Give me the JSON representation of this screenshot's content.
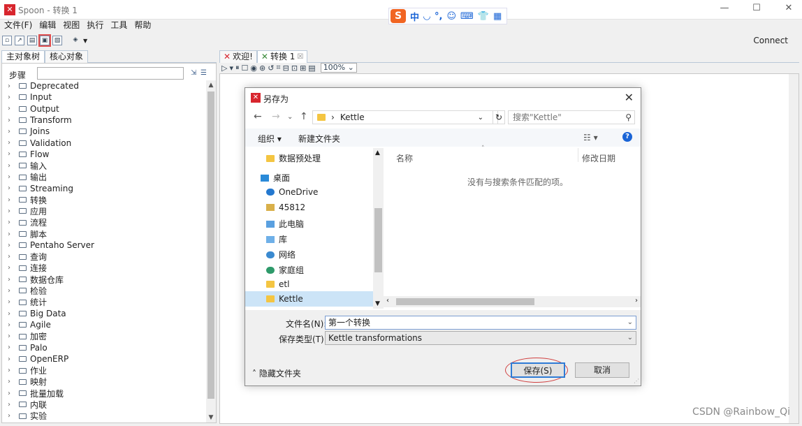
{
  "window": {
    "title": "Spoon - 转换 1",
    "icon": "kettle-icon",
    "minimize": "—",
    "maximize": "☐",
    "close": "✕"
  },
  "ime": {
    "logo": "S",
    "items": [
      "中",
      "◡",
      "°,",
      "☺",
      "⌨",
      "👕",
      "▦"
    ]
  },
  "menu": [
    "文件(F)",
    "编辑",
    "视图",
    "执行",
    "工具",
    "帮助"
  ],
  "toolbar": {
    "connect": "Connect"
  },
  "left_panel": {
    "tabs": [
      "主对象树",
      "核心对象"
    ],
    "steps_label": "步骤",
    "tree": [
      "Deprecated",
      "Input",
      "Output",
      "Transform",
      "Joins",
      "Validation",
      "Flow",
      "输入",
      "输出",
      "Streaming",
      "转换",
      "应用",
      "流程",
      "脚本",
      "Pentaho Server",
      "查询",
      "连接",
      "数据仓库",
      "检验",
      "统计",
      "Big Data",
      "Agile",
      "加密",
      "Palo",
      "OpenERP",
      "作业",
      "映射",
      "批量加载",
      "内联",
      "实验"
    ]
  },
  "workspace": {
    "tabs": [
      {
        "label": "欢迎!"
      },
      {
        "label": "转换 1",
        "close": "☒"
      }
    ],
    "zoom": "100%",
    "watermark": "CSDN @Rainbow_Qi"
  },
  "dialog": {
    "title": "另存为",
    "path_folder": "Kettle",
    "search_placeholder": "搜索\"Kettle\"",
    "organize": "组织 ▾",
    "new_folder": "新建文件夹",
    "nav_items": [
      "数据预处理",
      "桌面",
      "OneDrive",
      "45812",
      "此电脑",
      "库",
      "网络",
      "家庭组",
      "etl",
      "Kettle"
    ],
    "columns": [
      "名称",
      "修改日期"
    ],
    "empty_message": "没有与搜索条件匹配的项。",
    "filename_label": "文件名(N):",
    "filename_value": "第一个转换",
    "filetype_label": "保存类型(T):",
    "filetype_value": "Kettle transformations",
    "hide_folders": "隐藏文件夹",
    "save_button": "保存(S)",
    "cancel_button": "取消"
  }
}
